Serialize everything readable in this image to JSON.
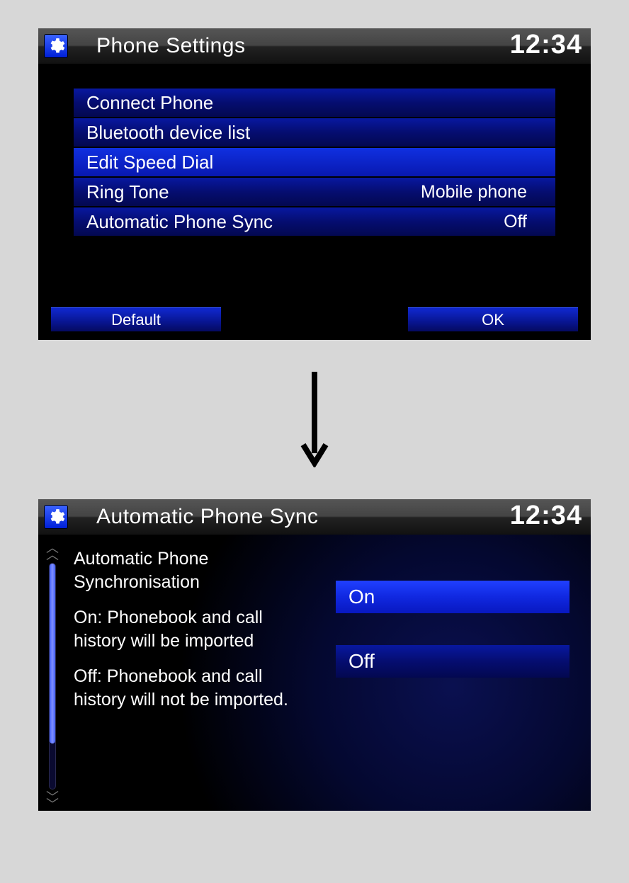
{
  "screen1": {
    "title": "Phone Settings",
    "clock": "12:34",
    "items": [
      {
        "label": "Connect Phone",
        "value": ""
      },
      {
        "label": "Bluetooth device list",
        "value": ""
      },
      {
        "label": "Edit Speed Dial",
        "value": ""
      },
      {
        "label": "Ring Tone",
        "value": "Mobile phone"
      },
      {
        "label": "Automatic Phone Sync",
        "value": "Off"
      }
    ],
    "buttons": {
      "left": "Default",
      "right": "OK"
    }
  },
  "screen2": {
    "title": "Automatic Phone Sync",
    "clock": "12:34",
    "desc_heading": "Automatic Phone Synchronisation",
    "desc_on": "On: Phonebook and call history will be imported",
    "desc_off": "Off: Phonebook and call history will not be imported.",
    "options": [
      {
        "label": "On"
      },
      {
        "label": "Off"
      }
    ]
  }
}
